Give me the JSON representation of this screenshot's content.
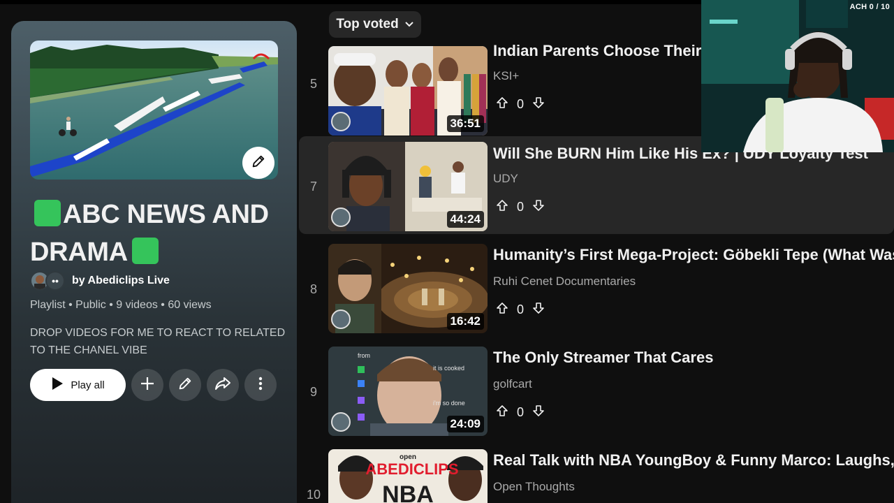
{
  "playlist": {
    "title_line1": "ABC NEWS AND",
    "title_line2": "DRAMA",
    "owner": "by Abediclips Live",
    "meta": "Playlist • Public • 9 videos • 60 views",
    "description": "DROP VIDEOS FOR ME TO REACT TO RELATED TO THE CHANEL VIBE",
    "play_all_label": "Play all",
    "avatar_more": "••"
  },
  "sort": {
    "label": "Top voted"
  },
  "videos": [
    {
      "index": "5",
      "title": "Indian Parents Choose Their I",
      "channel": "KSI+",
      "duration": "36:51",
      "votes": "0"
    },
    {
      "index": "7",
      "title": "Will She BURN Him Like His Ex? | UDY Loyalty Test",
      "channel": "UDY",
      "duration": "44:24",
      "votes": "0"
    },
    {
      "index": "8",
      "title": "Humanity’s First Mega-Project: Göbekli Tepe (What Was T",
      "channel": "Ruhi Cenet Documentaries",
      "duration": "16:42",
      "votes": "0"
    },
    {
      "index": "9",
      "title": "The Only Streamer That Cares",
      "channel": "golfcart",
      "duration": "24:09",
      "votes": "0"
    },
    {
      "index": "10",
      "title": "Real Talk with NBA YoungBoy & Funny Marco: Laughs, Lif",
      "channel": "Open Thoughts",
      "duration": "",
      "votes": ""
    }
  ],
  "thumb_text": {
    "t9_chat1": "from",
    "t9_chat2": "it is cooked",
    "t9_chat3": "i'm so done",
    "t10_top": "open",
    "t10_brand": "ABEDICLIPS",
    "t10_nba": "NBA"
  },
  "overlay": {
    "achievement": "ACH 0 / 10"
  },
  "colors": {
    "background": "#0f0f0f",
    "chip": "#272727",
    "accent_green": "#35c45b",
    "selected_row": "#272727"
  }
}
